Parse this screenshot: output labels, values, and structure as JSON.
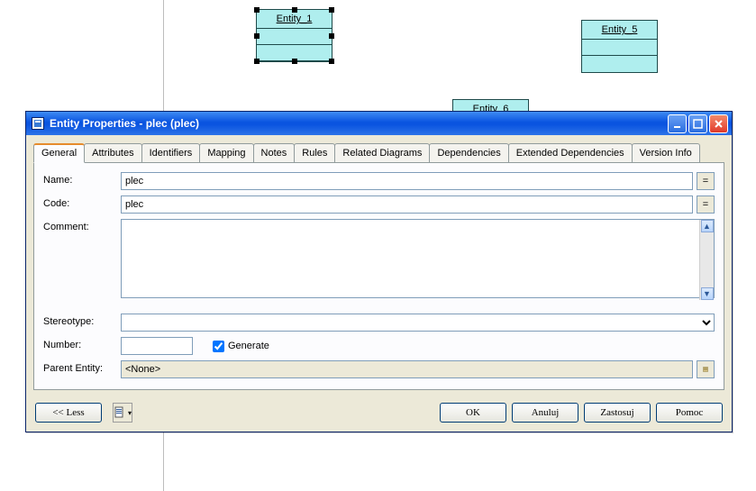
{
  "canvas": {
    "entities": [
      "Entity_1",
      "Entity_5",
      "Entity_6"
    ]
  },
  "dialog": {
    "title": "Entity Properties - plec (plec)",
    "tabs": [
      "General",
      "Attributes",
      "Identifiers",
      "Mapping",
      "Notes",
      "Rules",
      "Related Diagrams",
      "Dependencies",
      "Extended Dependencies",
      "Version Info"
    ],
    "activeTab": 0,
    "form": {
      "labels": {
        "name": "Name:",
        "code": "Code:",
        "comment": "Comment:",
        "stereotype": "Stereotype:",
        "number": "Number:",
        "generate": "Generate",
        "parent": "Parent Entity:"
      },
      "values": {
        "name": "plec",
        "code": "plec",
        "comment": "",
        "stereotype": "",
        "number": "",
        "generate": true,
        "parent": "<None>"
      },
      "eqBtn": "="
    },
    "footer": {
      "less": "<< Less",
      "ok": "OK",
      "cancel": "Anuluj",
      "apply": "Zastosuj",
      "help": "Pomoc"
    }
  }
}
